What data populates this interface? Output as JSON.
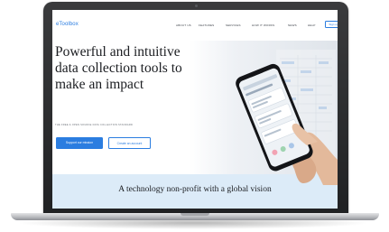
{
  "site": {
    "logo_text": "eToolbox"
  },
  "nav": {
    "items": [
      {
        "label": "ABOUT US"
      },
      {
        "label": "FEATURES"
      },
      {
        "label": "SERVICES"
      },
      {
        "label": "HOW IT WORKS"
      },
      {
        "label": "NEWS"
      },
      {
        "label": "HELP"
      }
    ],
    "signup_label": "Sign up"
  },
  "hero": {
    "title_lines": [
      "Powerful and intuitive",
      "data collection tools to",
      "make an impact"
    ],
    "subtitle": "THE FREE & OPEN SOURCE DATA COLLECTION STANDARD",
    "primary_button": "Support our mission",
    "secondary_button": "Create an account"
  },
  "mission": {
    "text": "A technology non-profit with a global vision"
  },
  "colors": {
    "accent": "#2b7de0",
    "mission_band": "#dcebf8",
    "laptop_frame": "#2b2c2e"
  }
}
